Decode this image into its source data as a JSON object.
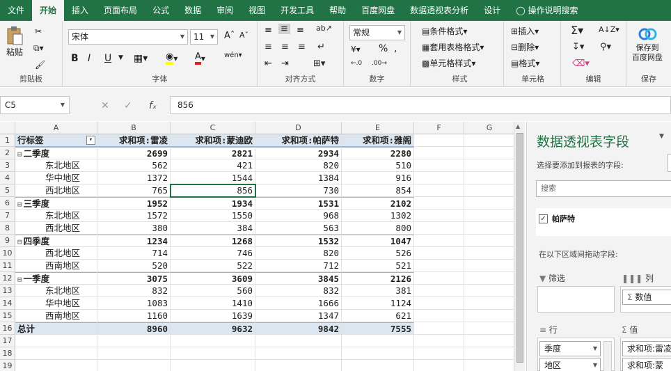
{
  "ribbon": {
    "tabs": [
      "文件",
      "开始",
      "插入",
      "页面布局",
      "公式",
      "数据",
      "审阅",
      "视图",
      "开发工具",
      "帮助",
      "百度网盘",
      "数据透视表分析",
      "设计"
    ],
    "tell_me": "操作说明搜索",
    "clipboard": {
      "paste": "粘贴"
    },
    "font": {
      "name": "宋体",
      "size": "11",
      "bold": "B",
      "italic": "I",
      "underline": "U"
    },
    "number": {
      "format": "常规"
    },
    "styles": [
      "条件格式",
      "套用表格格式",
      "单元格样式"
    ],
    "cells": [
      "插入",
      "删除",
      "格式"
    ],
    "save": {
      "line1": "保存到",
      "line2": "百度网盘"
    },
    "groups": [
      "剪贴板",
      "字体",
      "对齐方式",
      "数字",
      "样式",
      "单元格",
      "编辑",
      "保存"
    ]
  },
  "formula_bar": {
    "name_box": "C5",
    "value": "856"
  },
  "sheet": {
    "columns": [
      "A",
      "B",
      "C",
      "D",
      "E",
      "F",
      "G"
    ],
    "row_numbers": [
      "1",
      "2",
      "3",
      "4",
      "5",
      "6",
      "7",
      "8",
      "9",
      "10",
      "11",
      "12",
      "13",
      "14",
      "15",
      "16",
      "17",
      "18",
      "19"
    ],
    "header_row": [
      "行标签",
      "求和项:雷凌",
      "求和项:蒙迪欧",
      "求和项:帕萨特",
      "求和项:雅阁"
    ],
    "rows": [
      {
        "label": "二季度",
        "level": 0,
        "values": [
          "2699",
          "2821",
          "2934",
          "2280"
        ]
      },
      {
        "label": "东北地区",
        "level": 1,
        "values": [
          "562",
          "421",
          "820",
          "510"
        ]
      },
      {
        "label": "华中地区",
        "level": 1,
        "values": [
          "1372",
          "1544",
          "1384",
          "916"
        ]
      },
      {
        "label": "西北地区",
        "level": 1,
        "values": [
          "765",
          "856",
          "730",
          "854"
        ]
      },
      {
        "label": "三季度",
        "level": 0,
        "values": [
          "1952",
          "1934",
          "1531",
          "2102"
        ]
      },
      {
        "label": "东北地区",
        "level": 1,
        "values": [
          "1572",
          "1550",
          "968",
          "1302"
        ]
      },
      {
        "label": "西北地区",
        "level": 1,
        "values": [
          "380",
          "384",
          "563",
          "800"
        ]
      },
      {
        "label": "四季度",
        "level": 0,
        "values": [
          "1234",
          "1268",
          "1532",
          "1047"
        ]
      },
      {
        "label": "西北地区",
        "level": 1,
        "values": [
          "714",
          "746",
          "820",
          "526"
        ]
      },
      {
        "label": "西南地区",
        "level": 1,
        "values": [
          "520",
          "522",
          "712",
          "521"
        ]
      },
      {
        "label": "一季度",
        "level": 0,
        "values": [
          "3075",
          "3609",
          "3845",
          "2126"
        ]
      },
      {
        "label": "东北地区",
        "level": 1,
        "values": [
          "832",
          "560",
          "832",
          "381"
        ]
      },
      {
        "label": "华中地区",
        "level": 1,
        "values": [
          "1083",
          "1410",
          "1666",
          "1124"
        ]
      },
      {
        "label": "西南地区",
        "level": 1,
        "values": [
          "1160",
          "1639",
          "1347",
          "621"
        ]
      },
      {
        "label": "总计",
        "level": -1,
        "values": [
          "8960",
          "9632",
          "9842",
          "7555"
        ]
      }
    ],
    "collapse_symbol": "⊟"
  },
  "pivot_panel": {
    "title": "数据透视表字段",
    "choose_fields_label": "选择要添加到报表的字段:",
    "search_placeholder": "搜索",
    "fields": [
      {
        "label": "帕萨特",
        "checked": true
      }
    ],
    "drag_label": "在以下区域间拖动字段:",
    "areas": {
      "filters": "筛选",
      "columns": "列",
      "rows": "行",
      "values": "值"
    },
    "column_chips": [
      "数值"
    ],
    "row_chips": [
      "季度",
      "地区"
    ],
    "value_chips": [
      "求和项:雷凌",
      "求和项:蒙"
    ]
  },
  "colors": {
    "accent": "#217346",
    "header_row_fill": "#dce6f1",
    "selection_border": "#217346"
  }
}
